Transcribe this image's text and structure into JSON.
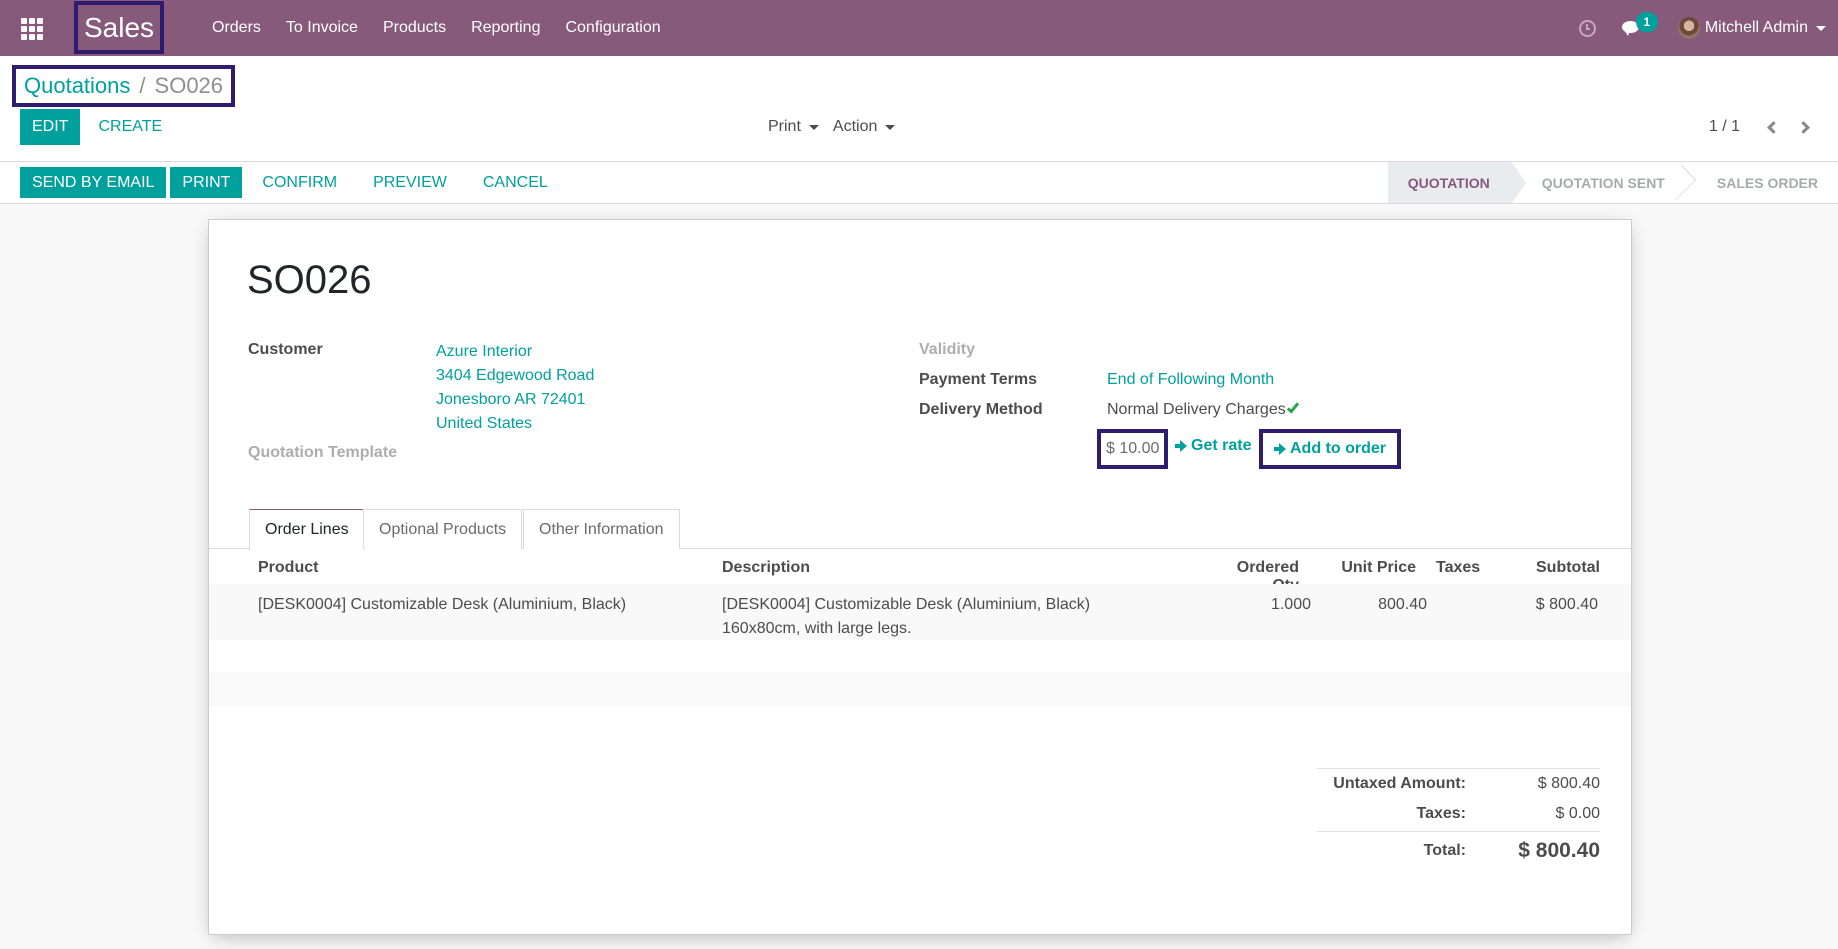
{
  "navbar": {
    "app_name": "Sales",
    "menu": [
      "Orders",
      "To Invoice",
      "Products",
      "Reporting",
      "Configuration"
    ],
    "messages_badge": "1",
    "user_name": "Mitchell Admin",
    "brand_color": "#875a7b"
  },
  "control_panel": {
    "breadcrumb": {
      "parent": "Quotations",
      "separator": "/",
      "current": "SO026"
    },
    "edit_label": "Edit",
    "create_label": "Create",
    "print_label": "Print",
    "action_label": "Action",
    "pager": "1 / 1"
  },
  "statusbar": {
    "buttons": [
      "Send by Email",
      "Print",
      "Confirm",
      "Preview",
      "Cancel"
    ],
    "stages": [
      "Quotation",
      "Quotation Sent",
      "Sales Order"
    ],
    "active_stage": "Quotation"
  },
  "form": {
    "title": "SO026",
    "customer_label": "Customer",
    "customer": {
      "name": "Azure Interior",
      "street": "3404 Edgewood Road",
      "city": "Jonesboro AR 72401",
      "country": "United States"
    },
    "quotation_template_label": "Quotation Template",
    "validity_label": "Validity",
    "payment_terms_label": "Payment Terms",
    "payment_terms": "End of Following Month",
    "delivery_method_label": "Delivery Method",
    "delivery_method": "Normal Delivery Charges",
    "delivery_rate": "$ 10.00",
    "get_rate_label": "Get rate",
    "add_to_order_label": "Add to order"
  },
  "tabs": [
    "Order Lines",
    "Optional Products",
    "Other Information"
  ],
  "order_lines": {
    "columns": [
      "Product",
      "Description",
      "Ordered Qty",
      "Unit Price",
      "Taxes",
      "Subtotal"
    ],
    "rows": [
      {
        "product": "[DESK0004] Customizable Desk (Aluminium, Black)",
        "description_line1": "[DESK0004] Customizable Desk (Aluminium, Black)",
        "description_line2": "160x80cm, with large legs.",
        "qty": "1.000",
        "unit_price": "800.40",
        "taxes": "",
        "subtotal": "$ 800.40"
      }
    ]
  },
  "totals": {
    "untaxed_label": "Untaxed Amount:",
    "untaxed": "$ 800.40",
    "taxes_label": "Taxes:",
    "taxes": "$ 0.00",
    "total_label": "Total:",
    "total": "$ 800.40"
  }
}
